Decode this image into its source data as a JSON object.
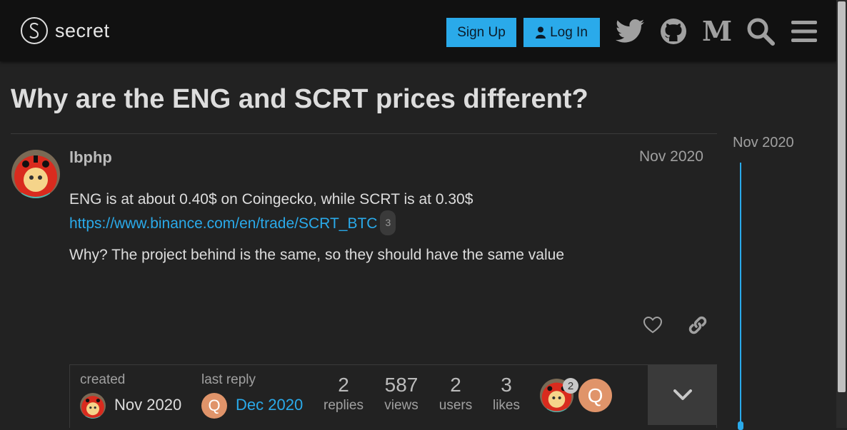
{
  "header": {
    "logo_text": "secret",
    "signup_label": "Sign Up",
    "login_label": "Log In",
    "icons": [
      "twitter-icon",
      "github-icon",
      "medium-icon",
      "search-icon",
      "hamburger-menu-icon"
    ]
  },
  "topic": {
    "title": "Why are the ENG and SCRT prices different?"
  },
  "post": {
    "username": "lbphp",
    "date": "Nov 2020",
    "line1": "ENG is at about 0.40$ on Coingecko, while SCRT is at 0.30$",
    "link": "https://www.binance.com/en/trade/SCRT_BTC",
    "link_clicks": "3",
    "line2": "Why? The project behind is the same, so they should have the same value"
  },
  "timeline": {
    "date": "Nov 2020"
  },
  "topic_map": {
    "created_label": "created",
    "created_date": "Nov 2020",
    "last_reply_label": "last reply",
    "last_reply_date": "Dec 2020",
    "last_reply_avatar_letter": "Q",
    "replies": "2",
    "replies_label": "replies",
    "views": "587",
    "views_label": "views",
    "users": "2",
    "users_label": "users",
    "likes": "3",
    "likes_label": "likes",
    "participant_post_count": "2",
    "participant_q_letter": "Q"
  },
  "colors": {
    "accent": "#2aaaea",
    "background": "#222222",
    "header": "#111111",
    "q_avatar": "#e0946a"
  }
}
